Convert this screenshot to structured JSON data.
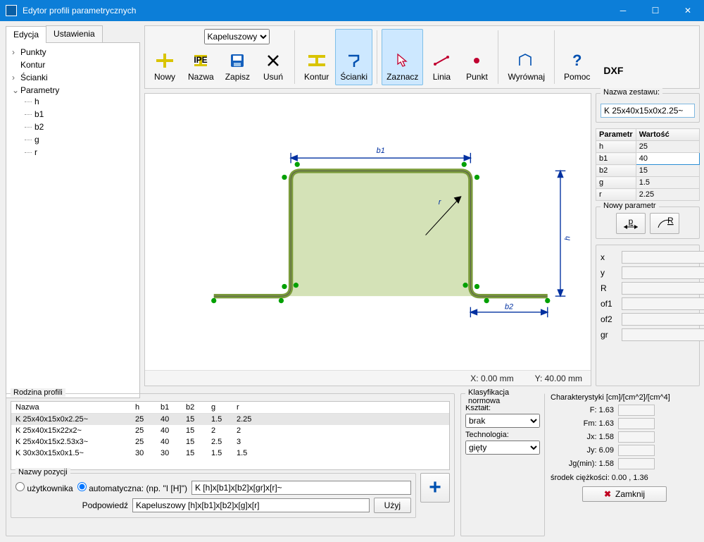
{
  "window": {
    "title": "Edytor profili parametrycznych"
  },
  "tabs": {
    "edit": "Edycja",
    "settings": "Ustawienia"
  },
  "tree": {
    "punkty": "Punkty",
    "kontur": "Kontur",
    "scianki": "Ścianki",
    "parametry": "Parametry",
    "params": [
      "h",
      "b1",
      "b2",
      "g",
      "r"
    ]
  },
  "toolbar": {
    "nowy": "Nowy",
    "profile_type": "Kapeluszowy",
    "nazwa": "Nazwa",
    "zapisz": "Zapisz",
    "usun": "Usuń",
    "kontur": "Kontur",
    "scianki": "Ścianki",
    "zaznacz": "Zaznacz",
    "linia": "Linia",
    "punkt": "Punkt",
    "wyrownaj": "Wyrównaj",
    "pomoc": "Pomoc",
    "dxf": "DXF"
  },
  "canvas": {
    "b1": "b1",
    "b2": "b2",
    "h": "h",
    "r": "r",
    "status_x": "X: 0.00 mm",
    "status_y": "Y: 40.00 mm"
  },
  "rpanel": {
    "set_title": "Nazwa zestawu:",
    "set_name": "K 25x40x15x0x2.25~",
    "col_param": "Parametr",
    "col_value": "Wartość",
    "rows": [
      {
        "k": "h",
        "v": "25"
      },
      {
        "k": "b1",
        "v": "40"
      },
      {
        "k": "b2",
        "v": "15"
      },
      {
        "k": "g",
        "v": "1.5"
      },
      {
        "k": "r",
        "v": "2.25"
      }
    ],
    "new_param": "Nowy parametr",
    "fields": {
      "x": "x",
      "y": "y",
      "R": "R",
      "of1": "of1",
      "of2": "of2",
      "gr": "gr"
    }
  },
  "family": {
    "title": "Rodzina profili",
    "cols": [
      "Nazwa",
      "h",
      "b1",
      "b2",
      "g",
      "r"
    ],
    "rows": [
      {
        "n": "K 25x40x15x0x2.25~",
        "h": "25",
        "b1": "40",
        "b2": "15",
        "g": "1.5",
        "r": "2.25",
        "sel": true
      },
      {
        "n": "K 25x40x15x22x2~",
        "h": "25",
        "b1": "40",
        "b2": "15",
        "g": "2",
        "r": "2"
      },
      {
        "n": "K 25x40x15x2.53x3~",
        "h": "25",
        "b1": "40",
        "b2": "15",
        "g": "2.5",
        "r": "3"
      },
      {
        "n": "K 30x30x15x0x1.5~",
        "h": "30",
        "b1": "30",
        "b2": "15",
        "g": "1.5",
        "r": "1.5"
      }
    ]
  },
  "names": {
    "title": "Nazwy pozycji",
    "user": "użytkownika",
    "auto": "automatyczna: (np. \"I [H]\")",
    "pattern": "K [h]x[b1]x[b2]x[gr]x[r]~",
    "hint_label": "Podpowiedź",
    "hint": "Kapeluszowy [h]x[b1]x[b2]x[g]x[r]",
    "use": "Użyj"
  },
  "klas": {
    "title": "Klasyfikacja normowa",
    "shape_label": "Kształt:",
    "shape": "brak",
    "tech_label": "Technologia:",
    "tech": "gięty"
  },
  "chars": {
    "title": "Charakterystyki [cm]/[cm^2]/[cm^4]",
    "rows": [
      {
        "l": "F: 1.63"
      },
      {
        "l": "Fm: 1.63"
      },
      {
        "l": "Jx: 1.58"
      },
      {
        "l": "Jy: 6.09"
      },
      {
        "l": "Jg(min): 1.58"
      }
    ],
    "cog": "środek ciężkości:    0.00 , 1.36",
    "close": "Zamknij"
  }
}
